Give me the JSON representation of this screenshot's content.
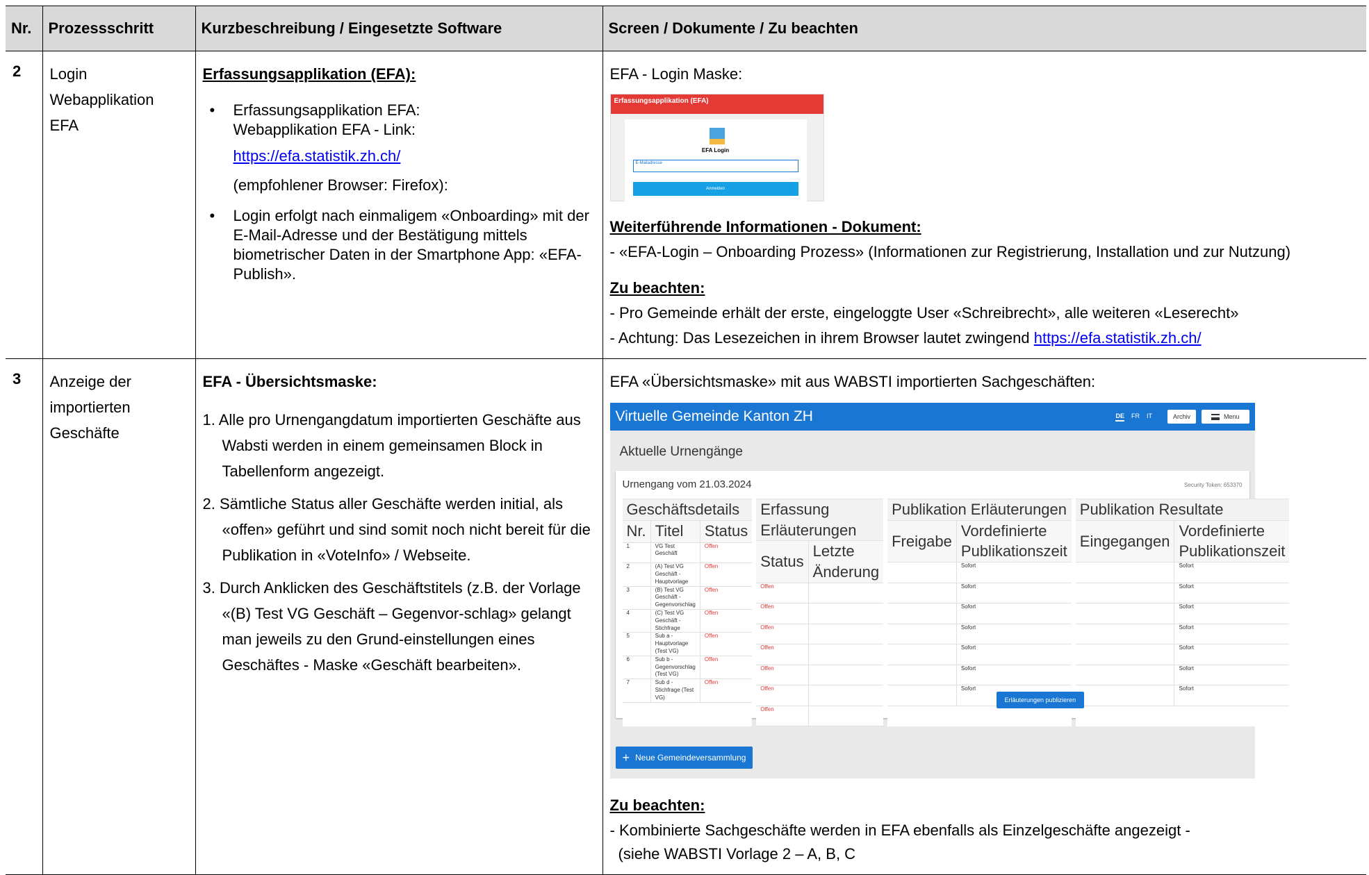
{
  "headers": {
    "nr": "Nr.",
    "step": "Prozessschritt",
    "desc": "Kurzbeschreibung / Eingesetzte Software",
    "screen": "Screen / Dokumente / Zu beachten"
  },
  "row2": {
    "nr": "2",
    "step_lines": [
      "Login",
      "Webapplikation",
      "EFA"
    ],
    "desc_heading": "Erfassungsapplikation (EFA):",
    "bullet1_l1": "Erfassungsapplikation EFA:",
    "bullet1_l2": "Webapplikation EFA - Link:",
    "link": "https://efa.statistik.zh.ch/",
    "browser_note": "(empfohlener Browser: Firefox):",
    "bullet2": "Login erfolgt nach einmaligem «Onboarding» mit der E-Mail-Adresse und der Bestätigung mittels biometrischer Daten in der Smartphone App: «EFA-Publish».",
    "screen_intro": "EFA - Login Maske:",
    "login_mock": {
      "header": "Erfassungsapplikation (EFA)",
      "title": "EFA Login",
      "field_label": "E-Mailadresse",
      "button": "Anmelden"
    },
    "info_heading": "Weiterführende Informationen - Dokument:",
    "info_text": "- «EFA-Login – Onboarding Prozess» (Informationen zur Registrierung, Installation und zur Nutzung)",
    "note_heading": "Zu beachten:",
    "note1": "- Pro Gemeinde erhält der erste, eingeloggte User «Schreibrecht», alle weiteren «Leserecht»",
    "note2_prefix": "- Achtung: Das Lesezeichen in ihrem Browser lautet zwingend ",
    "note2_link": "https://efa.statistik.zh.ch/"
  },
  "row3": {
    "nr": "3",
    "step_lines": [
      "Anzeige der",
      "importierten",
      "Geschäfte"
    ],
    "desc_heading": "EFA - Übersichtsmaske:",
    "item1": "1. Alle pro Urnengangdatum importierten Geschäfte aus Wabsti werden in einem gemeinsamen Block in Tabellenform angezeigt.",
    "item2": "2. Sämtliche Status aller Geschäfte werden initial, als «offen» geführt und sind somit noch nicht bereit für die Publikation in «VoteInfo» / Webseite.",
    "item3": "3. Durch Anklicken des Geschäftstitels (z.B. der Vorlage «(B) Test VG Geschäft – Gegenvor-schlag» gelangt man jeweils zu den Grund-einstellungen eines Geschäftes - Maske «Geschäft bearbeiten».",
    "screen_intro": "EFA «Übersichtsmaske» mit aus WABSTI importierten Sachgeschäften:",
    "note_heading": "Zu beachten:",
    "note1": "- Kombinierte Sachgeschäfte werden in EFA ebenfalls als Einzelgeschäfte angezeigt -",
    "note2": "(siehe WABSTI Vorlage 2 – A, B, C"
  },
  "overview": {
    "app_title": "Virtuelle Gemeinde Kanton ZH",
    "langs": [
      "DE",
      "FR",
      "IT"
    ],
    "archiv": "Archiv",
    "menu": "Menu",
    "subtitle": "Aktuelle Urnengänge",
    "urnengang": "Urnengang vom 21.03.2024",
    "token": "Security Token: 653370",
    "groups": {
      "details": "Geschäftsdetails",
      "erfassung": "Erfassung Erläuterungen",
      "publikation": "Publikation Erläuterungen",
      "resultate": "Publikation Resultate"
    },
    "cols": {
      "nr": "Nr.",
      "titel": "Titel",
      "status": "Status",
      "e_status": "Status",
      "letzte": "Letzte Änderung",
      "freigabe": "Freigabe",
      "vordef": "Vordefinierte Publikationszeit",
      "eingegangen": "Eingegangen",
      "vordef2": "Vordefinierte Publikationszeit"
    },
    "rows": [
      {
        "nr": "1",
        "titel": "VG Test Geschäft",
        "status": "Offen",
        "e_status": "Offen",
        "pub": "Sofort",
        "res": "Sofort"
      },
      {
        "nr": "2",
        "titel": "(A) Test VG Geschäft - Hauptvorlage",
        "status": "Offen",
        "e_status": "Offen",
        "pub": "Sofort",
        "res": "Sofort"
      },
      {
        "nr": "3",
        "titel": "(B) Test VG Geschäft - Gegenvorschlag",
        "status": "Offen",
        "e_status": "Offen",
        "pub": "Sofort",
        "res": "Sofort"
      },
      {
        "nr": "4",
        "titel": "(C) Test VG Geschäft - Stichfrage",
        "status": "Offen",
        "e_status": "Offen",
        "pub": "Sofort",
        "res": "Sofort"
      },
      {
        "nr": "5",
        "titel": "Sub a - Hauptvorlage (Test VG)",
        "status": "Offen",
        "e_status": "Offen",
        "pub": "Sofort",
        "res": "Sofort"
      },
      {
        "nr": "6",
        "titel": "Sub b - Gegenvorschlag (Test VG)",
        "status": "Offen",
        "e_status": "Offen",
        "pub": "Sofort",
        "res": "Sofort"
      },
      {
        "nr": "7",
        "titel": "Sub d - Stichfrage (Test VG)",
        "status": "Offen",
        "e_status": "Offen",
        "pub": "Sofort",
        "res": "Sofort"
      }
    ],
    "publish_button": "Erläuterungen publizieren",
    "new_button": "Neue Gemeindeversammlung"
  }
}
